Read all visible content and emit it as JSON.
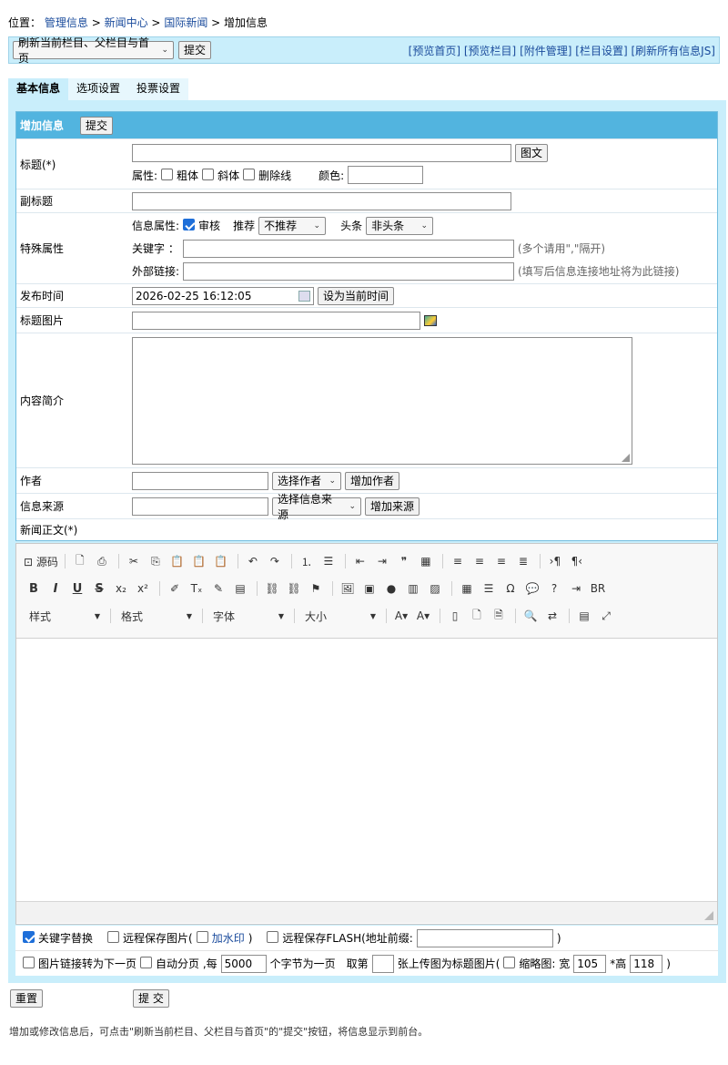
{
  "location": {
    "prefix": "位置：",
    "crumb1": "管理信息",
    "sep": ">",
    "crumb2": "新闻中心",
    "crumb3": "国际新闻",
    "current": "增加信息"
  },
  "topbar": {
    "refresh_select": "刷新当前栏目、父栏目与首页",
    "submit": "提交",
    "links": [
      "[预览首页]",
      "[预览栏目]",
      "[附件管理]",
      "[栏目设置]",
      "[刷新所有信息JS]"
    ]
  },
  "tabs": [
    "基本信息",
    "选项设置",
    "投票设置"
  ],
  "form": {
    "header": "增加信息",
    "header_submit": "提交",
    "title": {
      "label": "标题(*)",
      "pic_text_btn": "图文",
      "attr_label": "属性:",
      "bold": "粗体",
      "italic": "斜体",
      "strike": "删除线",
      "color_label": "颜色:"
    },
    "subtitle": {
      "label": "副标题"
    },
    "special": {
      "label": "特殊属性",
      "info_attr": "信息属性:",
      "audit": "审核",
      "recommend_label": "推荐",
      "recommend_value": "不推荐",
      "headline_label": "头条",
      "headline_value": "非头条",
      "keywords_label": "关键字 ：",
      "keywords_hint": "(多个请用\",\"隔开)",
      "extlink_label": "外部链接:",
      "extlink_hint": "(填写后信息连接地址将为此链接)"
    },
    "pubtime": {
      "label": "发布时间",
      "value": "2026-02-25 16:12:05",
      "set_now": "设为当前时间"
    },
    "titlepic": {
      "label": "标题图片"
    },
    "summary": {
      "label": "内容简介"
    },
    "author": {
      "label": "作者",
      "select": "选择作者",
      "add": "增加作者"
    },
    "source": {
      "label": "信息来源",
      "select": "选择信息来源",
      "add": "增加来源"
    },
    "content": {
      "label": "新闻正文(*)"
    }
  },
  "editor": {
    "row1": [
      {
        "name": "source-icon",
        "glyph": "⊡ 源码"
      },
      {
        "name": "sep"
      },
      {
        "name": "preview-icon",
        "glyph": "🗋"
      },
      {
        "name": "print-icon",
        "glyph": "⎙"
      },
      {
        "name": "sep"
      },
      {
        "name": "cut-icon",
        "glyph": "✂"
      },
      {
        "name": "copy-icon",
        "glyph": "⎘"
      },
      {
        "name": "paste-icon",
        "glyph": "📋"
      },
      {
        "name": "paste-text-icon",
        "glyph": "📋"
      },
      {
        "name": "paste-word-icon",
        "glyph": "📋"
      },
      {
        "name": "sep"
      },
      {
        "name": "undo-icon",
        "glyph": "↶"
      },
      {
        "name": "redo-icon",
        "glyph": "↷"
      },
      {
        "name": "sep"
      },
      {
        "name": "numbered-list-icon",
        "glyph": "⒈"
      },
      {
        "name": "bulleted-list-icon",
        "glyph": "☰"
      },
      {
        "name": "sep"
      },
      {
        "name": "outdent-icon",
        "glyph": "⇤"
      },
      {
        "name": "indent-icon",
        "glyph": "⇥"
      },
      {
        "name": "blockquote-icon",
        "glyph": "❞"
      },
      {
        "name": "div-icon",
        "glyph": "▦"
      },
      {
        "name": "sep"
      },
      {
        "name": "align-left-icon",
        "glyph": "≡"
      },
      {
        "name": "align-center-icon",
        "glyph": "≡"
      },
      {
        "name": "align-right-icon",
        "glyph": "≡"
      },
      {
        "name": "align-justify-icon",
        "glyph": "≣"
      },
      {
        "name": "sep"
      },
      {
        "name": "ltr-icon",
        "glyph": "›¶"
      },
      {
        "name": "rtl-icon",
        "glyph": "¶‹"
      }
    ],
    "row2": [
      {
        "name": "bold-icon",
        "glyph": "B"
      },
      {
        "name": "italic-icon",
        "glyph": "I"
      },
      {
        "name": "underline-icon",
        "glyph": "U"
      },
      {
        "name": "strikethrough-icon",
        "glyph": "S"
      },
      {
        "name": "subscript-icon",
        "glyph": "x₂"
      },
      {
        "name": "superscript-icon",
        "glyph": "x²"
      },
      {
        "name": "sep"
      },
      {
        "name": "copy-format-icon",
        "glyph": "✐"
      },
      {
        "name": "remove-format-icon",
        "glyph": "Tₓ"
      },
      {
        "name": "clean-icon",
        "glyph": "✎"
      },
      {
        "name": "template-icon",
        "glyph": "▤"
      },
      {
        "name": "sep"
      },
      {
        "name": "link-icon",
        "glyph": "⛓"
      },
      {
        "name": "unlink-icon",
        "glyph": "⛓"
      },
      {
        "name": "anchor-icon",
        "glyph": "⚑"
      },
      {
        "name": "sep"
      },
      {
        "name": "image-icon",
        "glyph": "🖼"
      },
      {
        "name": "table-insert-icon",
        "glyph": "▣"
      },
      {
        "name": "flash-icon",
        "glyph": "●"
      },
      {
        "name": "media-icon",
        "glyph": "▥"
      },
      {
        "name": "file-icon",
        "glyph": "▨"
      },
      {
        "name": "sep"
      },
      {
        "name": "table-icon",
        "glyph": "▦"
      },
      {
        "name": "horizontal-rule-icon",
        "glyph": "☰"
      },
      {
        "name": "special-char-icon",
        "glyph": "Ω"
      },
      {
        "name": "smiley-icon",
        "glyph": "💬"
      },
      {
        "name": "about-icon",
        "glyph": "?"
      },
      {
        "name": "pagebreak-icon",
        "glyph": "⇥"
      },
      {
        "name": "page-break-icon",
        "glyph": "BR"
      }
    ],
    "row3_combos": [
      "样式",
      "格式",
      "字体",
      "大小"
    ],
    "row3": [
      {
        "name": "sep"
      },
      {
        "name": "text-color-icon",
        "glyph": "A▾"
      },
      {
        "name": "bg-color-icon",
        "glyph": "A▾"
      },
      {
        "name": "sep"
      },
      {
        "name": "show-blocks-icon",
        "glyph": "▯"
      },
      {
        "name": "new-page-icon",
        "glyph": "🗋"
      },
      {
        "name": "document-icon",
        "glyph": "🗎"
      },
      {
        "name": "sep"
      },
      {
        "name": "find-icon",
        "glyph": "🔍"
      },
      {
        "name": "replace-icon",
        "glyph": "⇄"
      },
      {
        "name": "sep"
      },
      {
        "name": "select-all-icon",
        "glyph": "▤"
      },
      {
        "name": "maximize-icon",
        "glyph": "⤢"
      }
    ]
  },
  "options": {
    "keyword_replace": "关键字替换",
    "remote_save_img": "远程保存图片(",
    "watermark": "加水印",
    "close_paren": ")",
    "remote_save_flash": "远程保存FLASH(地址前缀:",
    "img_link_next": "图片链接转为下一页",
    "auto_page": "自动分页 ,每",
    "page_chars": "5000",
    "chars_per_page": "个字节为一页",
    "take_nth": "取第",
    "upload_as_title": "张上传图为标题图片(",
    "thumbnail": "缩略图: 宽",
    "thumb_w": "105",
    "height_label": "*高",
    "thumb_h": "118"
  },
  "bottom": {
    "reset": "重置",
    "submit": "提 交"
  },
  "note": "增加或修改信息后，可点击\"刷新当前栏目、父栏目与首页\"的\"提交\"按钮，将信息显示到前台。"
}
